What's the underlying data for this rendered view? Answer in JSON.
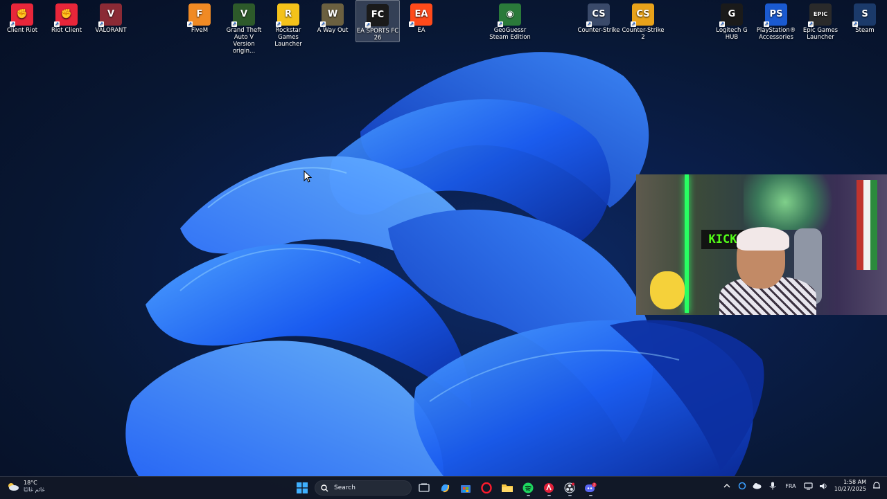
{
  "desktop": {
    "icons": [
      {
        "label": "Client Riot",
        "icon": "riot-icon",
        "color": "#e8263a"
      },
      {
        "label": "Riot Client",
        "icon": "riot-icon",
        "color": "#e8263a"
      },
      {
        "label": "VALORANT",
        "icon": "valorant-icon",
        "color": "#8b2a35"
      },
      {
        "label": "FiveM",
        "icon": "fivem-icon",
        "color": "#f08a24"
      },
      {
        "label": "Grand Theft Auto V Version origin...",
        "icon": "gta-icon",
        "color": "#2d5a2a"
      },
      {
        "label": "Rockstar Games Launcher",
        "icon": "rockstar-icon",
        "color": "#f4c21a"
      },
      {
        "label": "A Way Out",
        "icon": "a-way-out-icon",
        "color": "#6b6040"
      },
      {
        "label": "EA SPORTS FC 26",
        "icon": "ea-fc-icon",
        "color": "#1a1a1a"
      },
      {
        "label": "EA",
        "icon": "ea-icon",
        "color": "#ff4a1a"
      },
      {
        "label": "GeoGuessr Steam Edition",
        "icon": "geoguessr-icon",
        "color": "#2a7a3a"
      },
      {
        "label": "Counter-Strike",
        "icon": "counter-strike-icon",
        "color": "#3a4a6a"
      },
      {
        "label": "Counter-Strike 2",
        "icon": "counter-strike-2-icon",
        "color": "#e8a21a"
      },
      {
        "label": "Logitech G HUB",
        "icon": "logitech-icon",
        "color": "#1a1a1a"
      },
      {
        "label": "PlayStation® Accessories",
        "icon": "playstation-icon",
        "color": "#1a5ad0"
      },
      {
        "label": "Epic Games Launcher",
        "icon": "epic-games-icon",
        "color": "#2a2a2a"
      },
      {
        "label": "Steam",
        "icon": "steam-icon",
        "color": "#1b3a6a"
      }
    ],
    "webcam_sign": "KICK"
  },
  "taskbar": {
    "weather_temp": "18°C",
    "weather_condition": "غائم غالبًا",
    "search_placeholder": "Search",
    "language": "FRA",
    "time": "1:58 AM",
    "date": "10/27/2025",
    "chat_badge": "2"
  }
}
